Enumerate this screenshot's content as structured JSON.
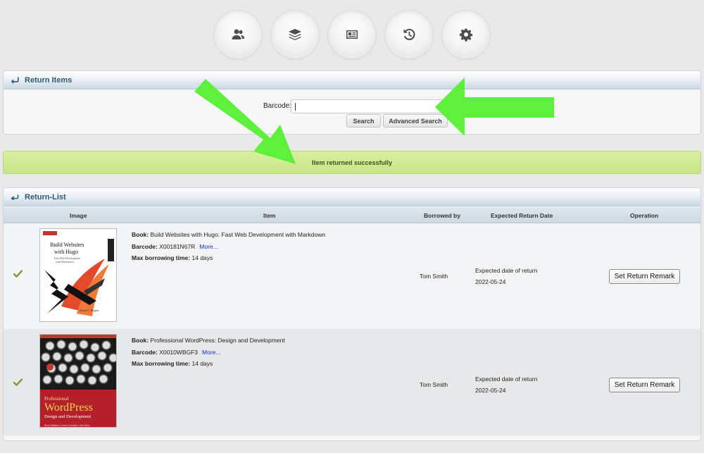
{
  "nav": {
    "icons": [
      "users-icon",
      "layers-icon",
      "id-card-icon",
      "history-icon",
      "gear-icon"
    ]
  },
  "return_panel": {
    "title": "Return Items",
    "barcode_label": "Barcode:",
    "barcode_value": "",
    "search_label": "Search",
    "advanced_search_label": "Advanced Search"
  },
  "success_message": "Item returned successfully",
  "return_list": {
    "title": "Return-List",
    "columns": [
      "Image",
      "Item",
      "Borrowed by",
      "Expected Return Date",
      "Operation"
    ],
    "rows": [
      {
        "book_label": "Book:",
        "book": "Build Websites with Hugo: Fast Web Development with Markdown",
        "barcode_label": "Barcode:",
        "barcode": "X00181N67R",
        "more": "More...",
        "max_label": "Max borrowing time:",
        "max_time": "14 days",
        "borrowed_by": "Tom Smith",
        "expected_label": "Expected date of return",
        "expected_date": "2022-05-24",
        "operation": "Set Return Remark",
        "cover": {
          "title_line1": "Build Websites",
          "title_line2": "with Hugo",
          "subtitle_line1": "Fast Web Development",
          "subtitle_line2": "with Markdown",
          "author": "Brian P. Hogan"
        }
      },
      {
        "book_label": "Book:",
        "book": "Professional WordPress: Design and Development",
        "barcode_label": "Barcode:",
        "barcode": "X0010WBGF3",
        "more": "More...",
        "max_label": "Max borrowing time:",
        "max_time": "14 days",
        "borrowed_by": "Tom Smith",
        "expected_label": "Expected date of return",
        "expected_date": "2022-05-24",
        "operation": "Set Return Remark",
        "cover": {
          "kicker": "Professional",
          "title": "WordPress",
          "subtitle": "Design and Development",
          "authors": "Brad Williams, David Damstra, Hal Stern"
        }
      }
    ]
  },
  "colors": {
    "accent": "#2e5878",
    "success_bg": "#d4ec96",
    "annotation_arrow": "#5ef03c",
    "link": "#1a31c9"
  }
}
